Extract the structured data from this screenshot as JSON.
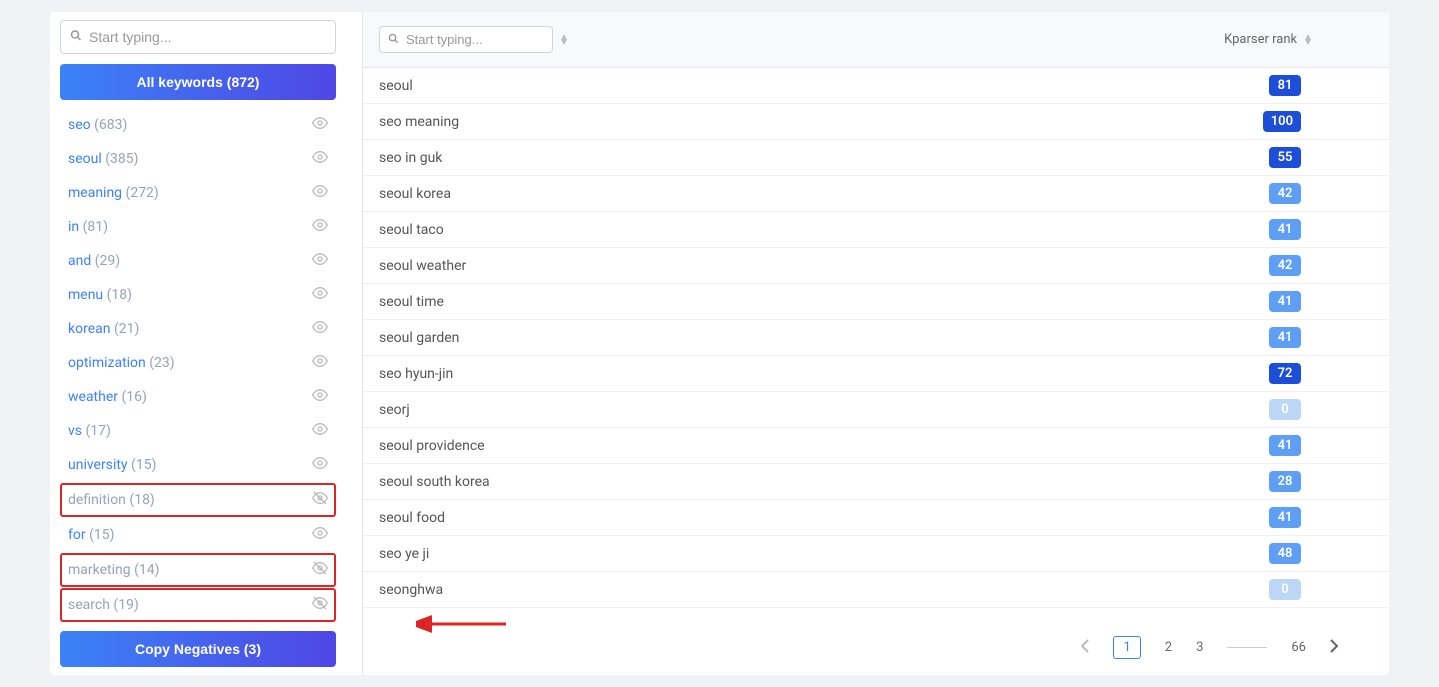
{
  "sidebar": {
    "search_placeholder": "Start typing...",
    "all_keywords_label": "All keywords (872)",
    "items": [
      {
        "label": "seo",
        "count": "(683)",
        "disabled": false,
        "highlighted": false
      },
      {
        "label": "seoul",
        "count": "(385)",
        "disabled": false,
        "highlighted": false
      },
      {
        "label": "meaning",
        "count": "(272)",
        "disabled": false,
        "highlighted": false
      },
      {
        "label": "in",
        "count": "(81)",
        "disabled": false,
        "highlighted": false
      },
      {
        "label": "and",
        "count": "(29)",
        "disabled": false,
        "highlighted": false
      },
      {
        "label": "menu",
        "count": "(18)",
        "disabled": false,
        "highlighted": false
      },
      {
        "label": "korean",
        "count": "(21)",
        "disabled": false,
        "highlighted": false
      },
      {
        "label": "optimization",
        "count": "(23)",
        "disabled": false,
        "highlighted": false
      },
      {
        "label": "weather",
        "count": "(16)",
        "disabled": false,
        "highlighted": false
      },
      {
        "label": "vs",
        "count": "(17)",
        "disabled": false,
        "highlighted": false
      },
      {
        "label": "university",
        "count": "(15)",
        "disabled": false,
        "highlighted": false
      },
      {
        "label": "definition",
        "count": "(18)",
        "disabled": true,
        "highlighted": true
      },
      {
        "label": "for",
        "count": "(15)",
        "disabled": false,
        "highlighted": false
      },
      {
        "label": "marketing",
        "count": "(14)",
        "disabled": true,
        "highlighted": true
      },
      {
        "label": "search",
        "count": "(19)",
        "disabled": true,
        "highlighted": true
      }
    ],
    "copy_negatives_label": "Copy Negatives (3)"
  },
  "table": {
    "search_placeholder": "Start typing...",
    "rank_header": "Kparser rank",
    "rows": [
      {
        "keyword": "seoul",
        "rank": "81",
        "tone": "dark"
      },
      {
        "keyword": "seo meaning",
        "rank": "100",
        "tone": "dark"
      },
      {
        "keyword": "seo in guk",
        "rank": "55",
        "tone": "dark"
      },
      {
        "keyword": "seoul korea",
        "rank": "42",
        "tone": "mid"
      },
      {
        "keyword": "seoul taco",
        "rank": "41",
        "tone": "mid"
      },
      {
        "keyword": "seoul weather",
        "rank": "42",
        "tone": "mid"
      },
      {
        "keyword": "seoul time",
        "rank": "41",
        "tone": "mid"
      },
      {
        "keyword": "seoul garden",
        "rank": "41",
        "tone": "mid"
      },
      {
        "keyword": "seo hyun-jin",
        "rank": "72",
        "tone": "dark"
      },
      {
        "keyword": "seorj",
        "rank": "0",
        "tone": "light"
      },
      {
        "keyword": "seoul providence",
        "rank": "41",
        "tone": "mid"
      },
      {
        "keyword": "seoul south korea",
        "rank": "28",
        "tone": "mid"
      },
      {
        "keyword": "seoul food",
        "rank": "41",
        "tone": "mid"
      },
      {
        "keyword": "seo ye ji",
        "rank": "48",
        "tone": "mid"
      },
      {
        "keyword": "seonghwa",
        "rank": "0",
        "tone": "light"
      }
    ]
  },
  "pagination": {
    "pages": [
      "1",
      "2",
      "3"
    ],
    "last": "66",
    "current": "1"
  }
}
